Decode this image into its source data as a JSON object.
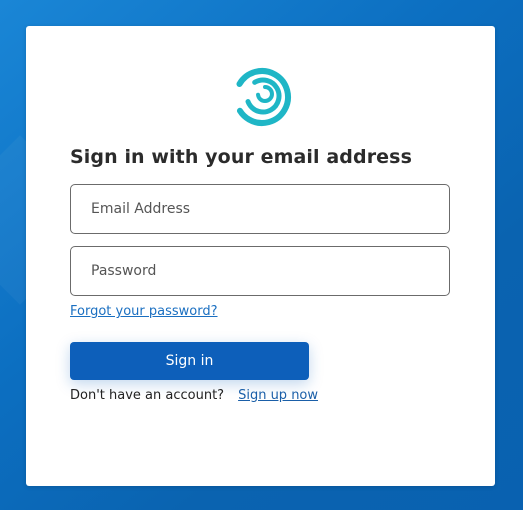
{
  "page": {
    "heading": "Sign in with your email address"
  },
  "form": {
    "email_placeholder": "Email Address",
    "email_value": "",
    "password_placeholder": "Password",
    "password_value": "",
    "forgot_link": "Forgot your password?",
    "signin_label": "Sign in"
  },
  "footer": {
    "no_account_text": "Don't have an account?",
    "signup_link": "Sign up now"
  },
  "colors": {
    "background": "#0b6fc0",
    "logo_teal": "#1fb6c6",
    "button": "#0d5fba",
    "link": "#1a6fc1"
  },
  "icons": {
    "logo": "swirl-logo-icon"
  }
}
